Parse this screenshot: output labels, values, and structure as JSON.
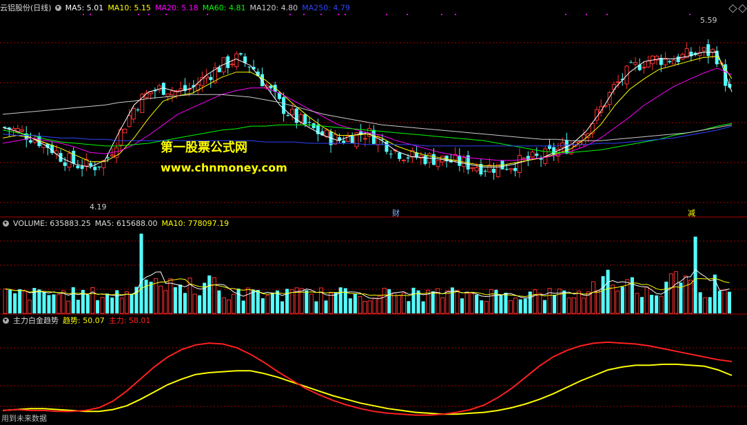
{
  "header_main": {
    "title": "云铝股份(日线)",
    "ma5": "MA5: 5.01",
    "ma10": "MA10: 5.15",
    "ma20": "MA20: 5.18",
    "ma60": "MA60: 4.81",
    "ma120": "MA120: 4.80",
    "ma250": "MA250: 4.79"
  },
  "header_volume": {
    "volume": "VOLUME: 635883.25",
    "ma5": "MA5: 615688.00",
    "ma10": "MA10: 778097.19"
  },
  "header_indicator": {
    "name": "主力白金趋势",
    "trend": "趋势: 50.07",
    "force": "主力: 58.01"
  },
  "price_labels": {
    "high": "5.59",
    "low": "4.19"
  },
  "markers": {
    "cai": "财",
    "jian": "减"
  },
  "watermark": {
    "line1": "第一股票公式网",
    "line2": "www.chnmoney.com"
  },
  "footer": {
    "note": "用到未来数据"
  },
  "colors": {
    "up": "#ff3232",
    "down": "#54ffff",
    "ma5": "#ffffff",
    "ma10": "#ffff00",
    "ma20": "#ff00ff",
    "ma60": "#00ff00",
    "ma120": "#cccccc",
    "ma250": "#2e45ff",
    "trend": "#ffff00",
    "force": "#ff2020",
    "grid": "#aa0000"
  },
  "chart_data": [
    {
      "type": "candlestick",
      "title": "云铝股份(日线)",
      "ylim": [
        4.19,
        5.59
      ],
      "extremes": {
        "high": 5.59,
        "low": 4.19
      },
      "ma_lines": {
        "MA5": [
          4.78,
          4.75,
          4.7,
          4.64,
          4.55,
          4.5,
          4.48,
          4.53,
          4.75,
          4.95,
          5.05,
          5.08,
          5.05,
          5.08,
          5.18,
          5.25,
          5.3,
          5.25,
          5.1,
          4.95,
          4.85,
          4.78,
          4.72,
          4.68,
          4.72,
          4.74,
          4.68,
          4.6,
          4.56,
          4.55,
          4.54,
          4.52,
          4.5,
          4.48,
          4.48,
          4.5,
          4.53,
          4.55,
          4.6,
          4.65,
          4.75,
          4.9,
          5.08,
          5.2,
          5.28,
          5.3,
          5.3,
          5.32,
          5.35,
          5.35,
          5.05
        ],
        "MA10": [
          4.7,
          4.72,
          4.7,
          4.66,
          4.62,
          4.57,
          4.52,
          4.52,
          4.58,
          4.7,
          4.85,
          4.98,
          5.02,
          5.04,
          5.1,
          5.16,
          5.2,
          5.2,
          5.14,
          5.05,
          4.95,
          4.86,
          4.78,
          4.72,
          4.72,
          4.73,
          4.7,
          4.64,
          4.6,
          4.57,
          4.55,
          4.53,
          4.51,
          4.49,
          4.49,
          4.51,
          4.53,
          4.55,
          4.58,
          4.62,
          4.7,
          4.8,
          4.95,
          5.07,
          5.15,
          5.22,
          5.25,
          5.28,
          5.31,
          5.32,
          5.15
        ],
        "MA20": [
          4.66,
          4.68,
          4.7,
          4.68,
          4.66,
          4.63,
          4.59,
          4.58,
          4.6,
          4.65,
          4.72,
          4.8,
          4.88,
          4.93,
          4.98,
          5.03,
          5.06,
          5.08,
          5.08,
          5.04,
          4.98,
          4.92,
          4.86,
          4.8,
          4.77,
          4.74,
          4.72,
          4.68,
          4.65,
          4.62,
          4.59,
          4.57,
          4.55,
          4.54,
          4.53,
          4.53,
          4.54,
          4.55,
          4.57,
          4.6,
          4.64,
          4.7,
          4.78,
          4.86,
          4.95,
          5.02,
          5.09,
          5.14,
          5.19,
          5.23,
          5.18
        ],
        "MA60": [
          4.76,
          4.74,
          4.72,
          4.69,
          4.67,
          4.66,
          4.65,
          4.64,
          4.64,
          4.65,
          4.66,
          4.68,
          4.7,
          4.72,
          4.74,
          4.76,
          4.77,
          4.79,
          4.79,
          4.8,
          4.8,
          4.8,
          4.79,
          4.78,
          4.77,
          4.76,
          4.75,
          4.74,
          4.73,
          4.72,
          4.71,
          4.7,
          4.69,
          4.68,
          4.66,
          4.64,
          4.62,
          4.6,
          4.59,
          4.59,
          4.6,
          4.61,
          4.63,
          4.65,
          4.67,
          4.69,
          4.72,
          4.74,
          4.76,
          4.79,
          4.81
        ],
        "MA120": [
          4.88,
          4.89,
          4.9,
          4.91,
          4.92,
          4.93,
          4.94,
          4.95,
          4.97,
          4.98,
          5.0,
          5.01,
          5.02,
          5.03,
          5.03,
          5.03,
          5.02,
          5.01,
          4.99,
          4.97,
          4.94,
          4.91,
          4.88,
          4.86,
          4.84,
          4.82,
          4.8,
          4.79,
          4.78,
          4.77,
          4.76,
          4.75,
          4.74,
          4.73,
          4.72,
          4.71,
          4.7,
          4.69,
          4.69,
          4.68,
          4.68,
          4.68,
          4.69,
          4.7,
          4.71,
          4.72,
          4.73,
          4.74,
          4.76,
          4.78,
          4.8
        ],
        "MA250": [
          4.73,
          4.72,
          4.72,
          4.71,
          4.7,
          4.7,
          4.69,
          4.69,
          4.68,
          4.68,
          4.68,
          4.68,
          4.68,
          4.68,
          4.68,
          4.68,
          4.68,
          4.68,
          4.67,
          4.67,
          4.67,
          4.66,
          4.66,
          4.66,
          4.66,
          4.65,
          4.65,
          4.65,
          4.65,
          4.64,
          4.64,
          4.64,
          4.64,
          4.64,
          4.64,
          4.64,
          4.64,
          4.64,
          4.64,
          4.65,
          4.65,
          4.66,
          4.66,
          4.67,
          4.68,
          4.69,
          4.7,
          4.72,
          4.74,
          4.76,
          4.79
        ]
      }
    },
    {
      "type": "bar",
      "title": "VOLUME",
      "ylabel": "VOLUME",
      "last": 635883.25,
      "ma5_last": 615688.0,
      "ma10_last": 778097.19
    },
    {
      "type": "line",
      "title": "主力白金趋势",
      "ylim": [
        0,
        100
      ],
      "series": [
        {
          "name": "趋势",
          "color": "#ffff00",
          "values": [
            12,
            13,
            14,
            14,
            13,
            12,
            11,
            11,
            13,
            17,
            24,
            32,
            40,
            46,
            51,
            53,
            54,
            55,
            55,
            52,
            48,
            43,
            38,
            33,
            28,
            24,
            20,
            17,
            14,
            12,
            10,
            9,
            8,
            8,
            9,
            10,
            12,
            15,
            19,
            24,
            30,
            37,
            44,
            50,
            56,
            59,
            61,
            61,
            62,
            62,
            61,
            60,
            56,
            50
          ]
        },
        {
          "name": "主力",
          "color": "#ff2020",
          "values": [
            12,
            13,
            12,
            12,
            11,
            11,
            12,
            15,
            22,
            33,
            46,
            59,
            70,
            78,
            83,
            85,
            84,
            80,
            73,
            64,
            54,
            45,
            36,
            29,
            23,
            18,
            14,
            11,
            9,
            8,
            7,
            7,
            8,
            10,
            13,
            18,
            26,
            36,
            48,
            60,
            70,
            77,
            82,
            85,
            86,
            85,
            84,
            82,
            79,
            76,
            73,
            70,
            67,
            65
          ]
        }
      ]
    }
  ]
}
